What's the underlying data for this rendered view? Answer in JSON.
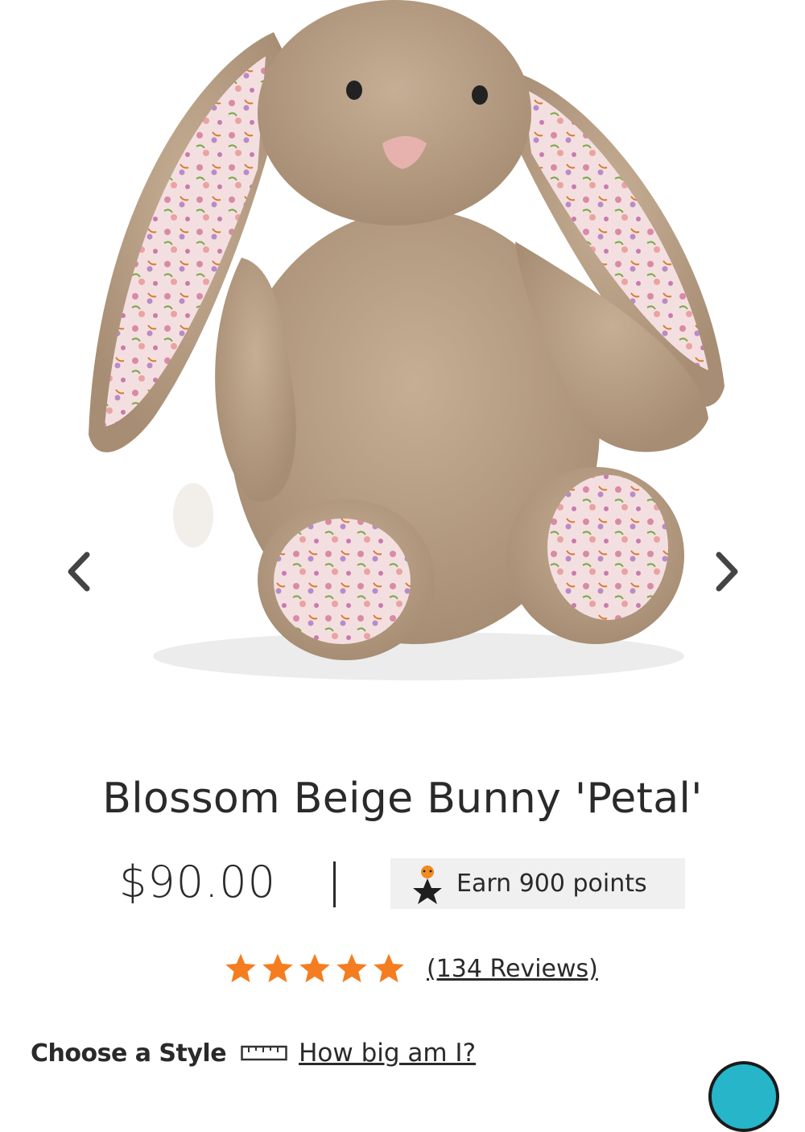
{
  "gallery": {
    "image_alt": "Blossom Beige Bunny plush toy with floral ears and feet",
    "prev_icon": "chevron-left-icon",
    "next_icon": "chevron-right-icon"
  },
  "product": {
    "title": "Blossom Beige Bunny 'Petal'",
    "price": "$90.00",
    "separator": "|",
    "points_label": "Earn 900 points",
    "points_icon": "reward-star-icon"
  },
  "rating": {
    "stars": 5,
    "star_color": "#f57c1f",
    "reviews_label": "(134 Reviews)"
  },
  "style": {
    "label": "Choose a Style",
    "ruler_icon": "ruler-icon",
    "size_link": "How big am I?"
  },
  "colors": {
    "text": "#2a2a2a",
    "points_bg": "#f0f0f0",
    "chat_accent": "#26b5c9"
  }
}
